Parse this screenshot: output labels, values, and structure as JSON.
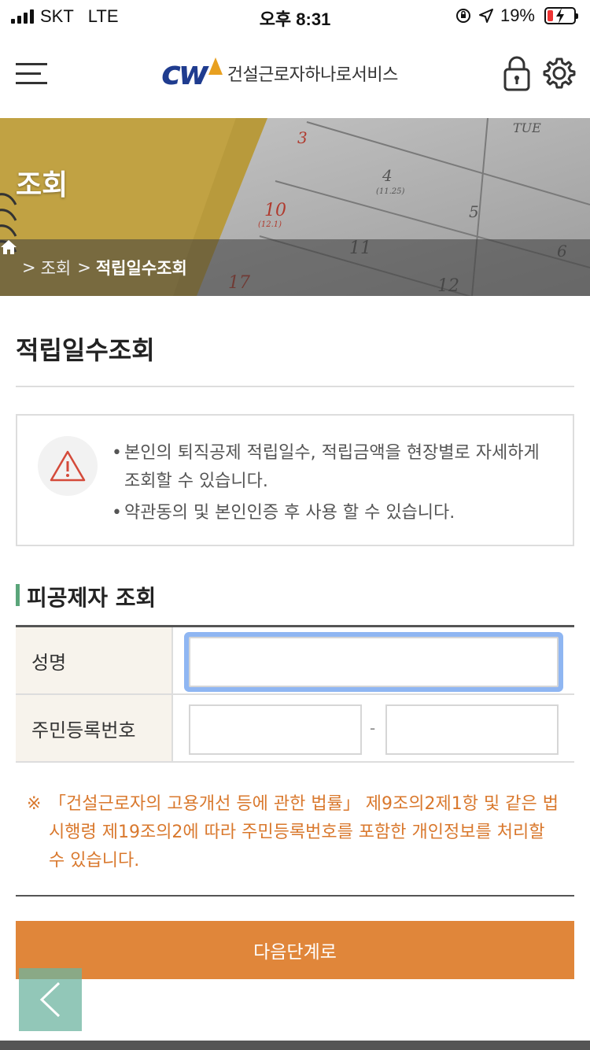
{
  "status_bar": {
    "carrier": "SKT",
    "network": "LTE",
    "time": "오후 8:31",
    "battery": "19%"
  },
  "header": {
    "logo_mark": "cw",
    "logo_text": "건설근로자하나로서비스",
    "icons": [
      "menu-icon",
      "lock-icon",
      "gear-icon"
    ]
  },
  "hero": {
    "title": "조회",
    "calendar_numbers": [
      "3",
      "4",
      "(11.25)",
      "5",
      "6",
      "10",
      "(12.1)",
      "11",
      "12",
      "17",
      "TUE"
    ],
    "breadcrumb": [
      "조회",
      "적립일수조회"
    ]
  },
  "page": {
    "title": "적립일수조회"
  },
  "notice": {
    "items": [
      "본인의 퇴직공제 적립일수, 적립금액을 현장별로 자세하게 조회할 수 있습니다.",
      "약관동의 및 본인인증 후 사용 할 수 있습니다."
    ]
  },
  "section": {
    "heading": "피공제자 조회"
  },
  "form": {
    "name_label": "성명",
    "name_value": "",
    "rrn_label": "주민등록번호",
    "rrn_dash": "-",
    "rrn_front_value": "",
    "rrn_back_value": ""
  },
  "legal_note": {
    "mark": "※",
    "text": "「건설근로자의 고용개선 등에 관한 법률」 제9조의2제1항 및 같은 법 시행령 제19조의2에 따라 주민등록번호를 포함한 개인정보를 처리할 수 있습니다."
  },
  "actions": {
    "next_label": "다음단계로"
  },
  "colors": {
    "accent_orange": "#e0863a",
    "legal_text": "#d9782d",
    "section_bar": "#5aa57a",
    "logo_blue": "#1f3c8f",
    "focus_ring": "#8fb6f2"
  }
}
